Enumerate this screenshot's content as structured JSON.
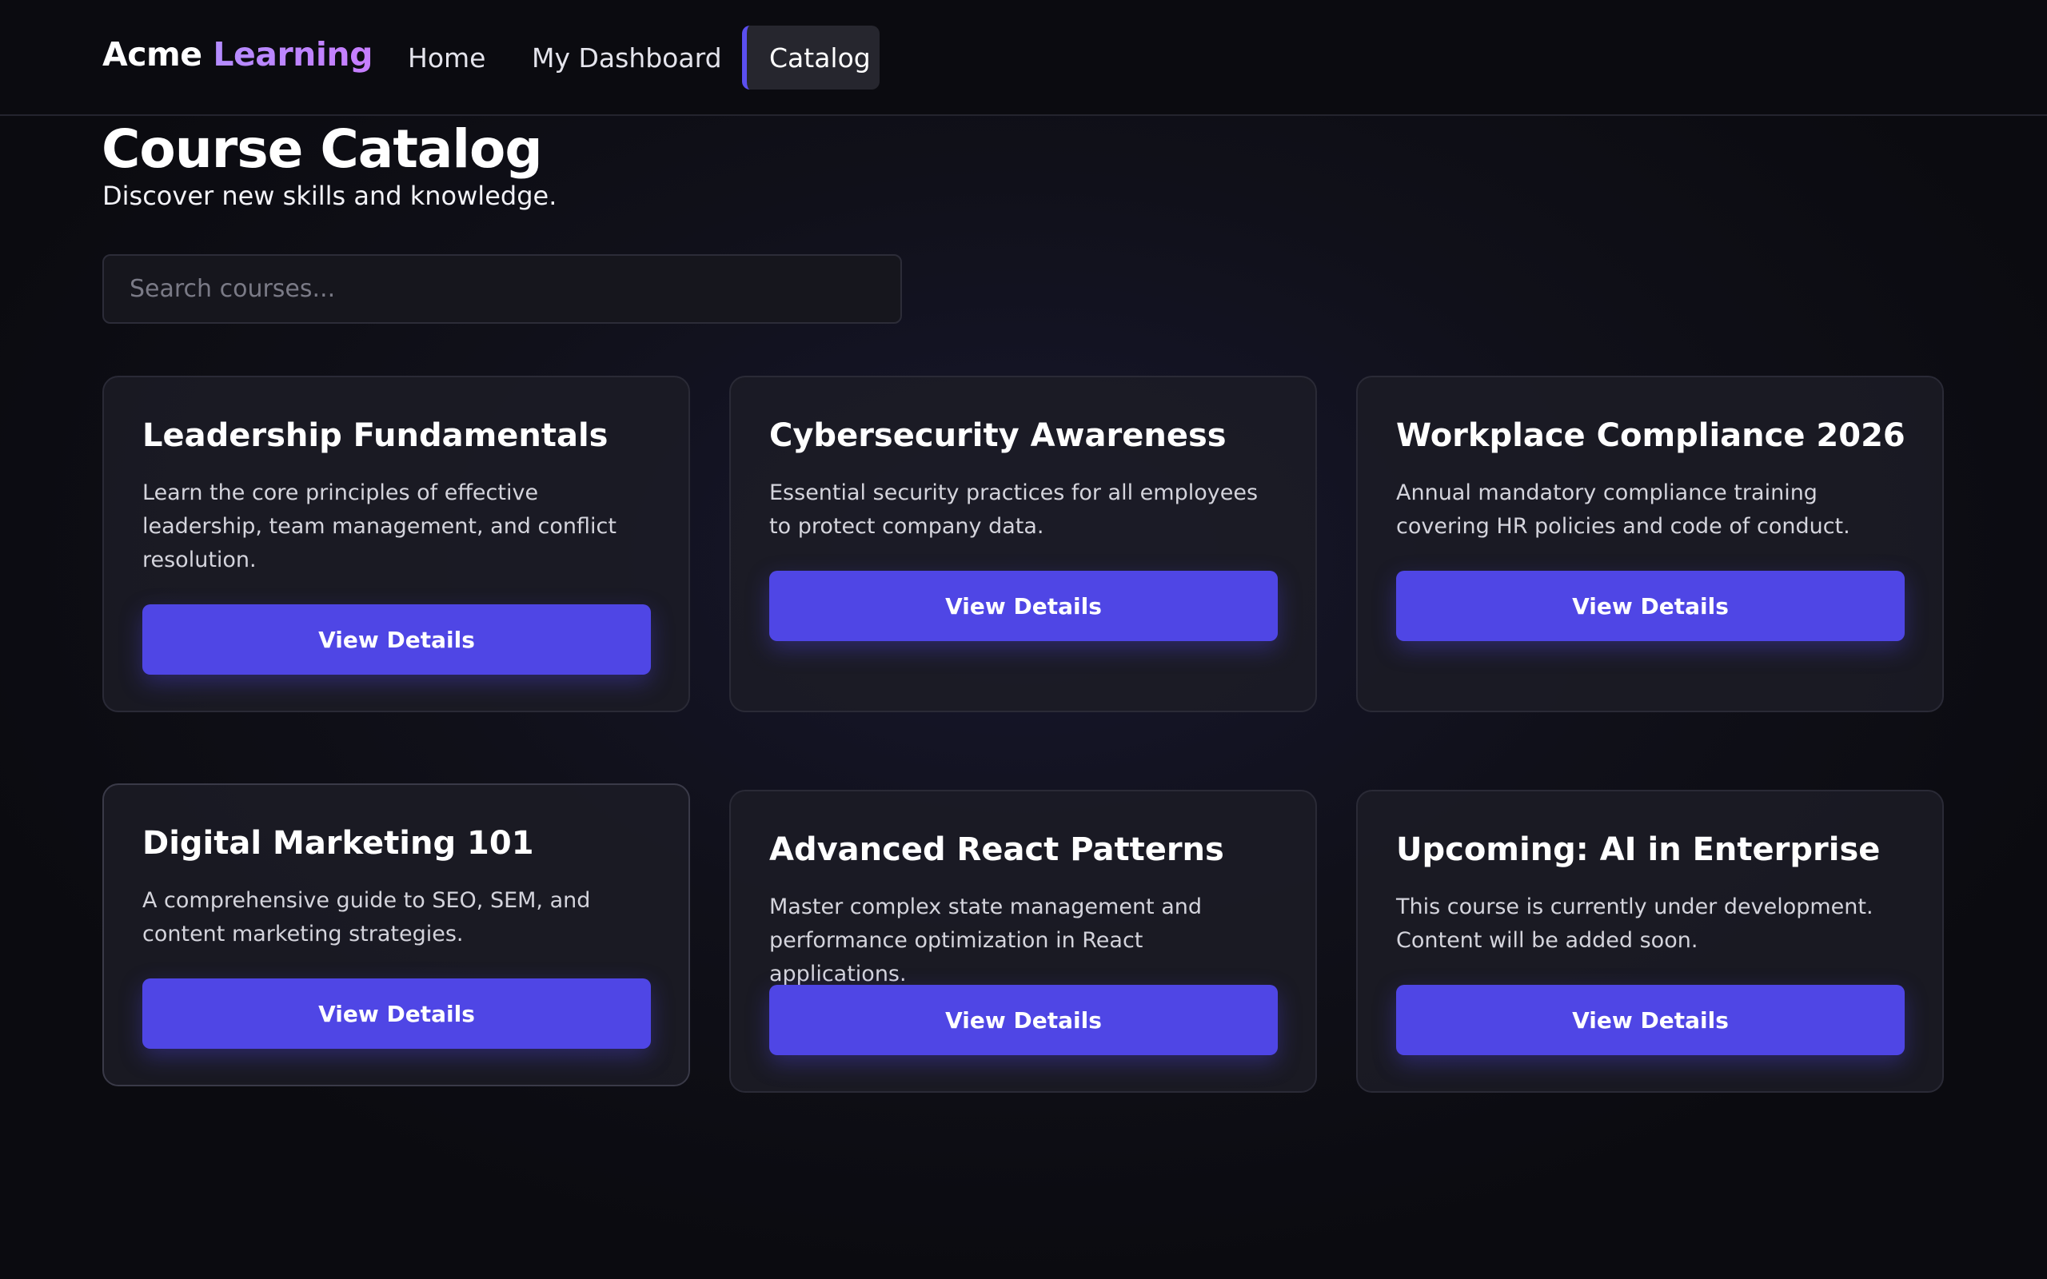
{
  "brand": {
    "part1": "Acme ",
    "part2": "Learning"
  },
  "nav": {
    "home": "Home",
    "dashboard": "My Dashboard",
    "catalog": "Catalog"
  },
  "page": {
    "title": "Course Catalog",
    "subtitle": "Discover new skills and knowledge."
  },
  "search": {
    "placeholder": "Search courses...",
    "value": ""
  },
  "courses": [
    {
      "title": "Leadership Fundamentals",
      "description": "Learn the core principles of effective leadership, team management, and conflict resolution.",
      "button": "View Details"
    },
    {
      "title": "Cybersecurity Awareness",
      "description": "Essential security practices for all employees to protect company data.",
      "button": "View Details"
    },
    {
      "title": "Workplace Compliance 2026",
      "description": "Annual mandatory compliance training covering HR policies and code of conduct.",
      "button": "View Details"
    },
    {
      "title": "Digital Marketing 101",
      "description": "A comprehensive guide to SEO, SEM, and content marketing strategies.",
      "button": "View Details"
    },
    {
      "title": "Advanced React Patterns",
      "description": "Master complex state management and performance optimization in React applications.",
      "button": "View Details"
    },
    {
      "title": "Upcoming: AI in Enterprise",
      "description": "This course is currently under development. Content will be added soon.",
      "button": "View Details"
    }
  ],
  "colors": {
    "accent": "#4f46e5",
    "brand_gradient": "#b48cff",
    "background": "#0b0b10",
    "card": "#1c1c26"
  }
}
